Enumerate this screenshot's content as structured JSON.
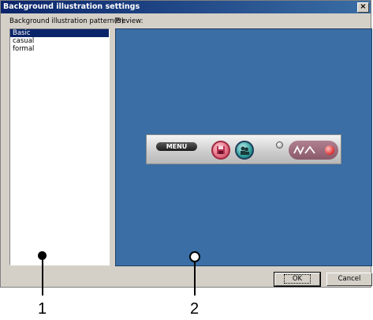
{
  "window": {
    "title": "Background illustration settings",
    "close_glyph": "×"
  },
  "labels": {
    "pattern": "Background illustration pattern(B):",
    "preview": "Preview:"
  },
  "patterns": [
    {
      "label": "Basic",
      "selected": true
    },
    {
      "label": "casual",
      "selected": false
    },
    {
      "label": "formal",
      "selected": false
    }
  ],
  "preview_toolbar": {
    "menu_label": "MENU"
  },
  "buttons": {
    "ok": "OK",
    "cancel": "Cancel"
  },
  "callouts": {
    "one": "1",
    "two": "2"
  },
  "colors": {
    "preview_bg": "#3a6ea5",
    "selection": "#0a246a",
    "title_bar": "#0a246a"
  }
}
